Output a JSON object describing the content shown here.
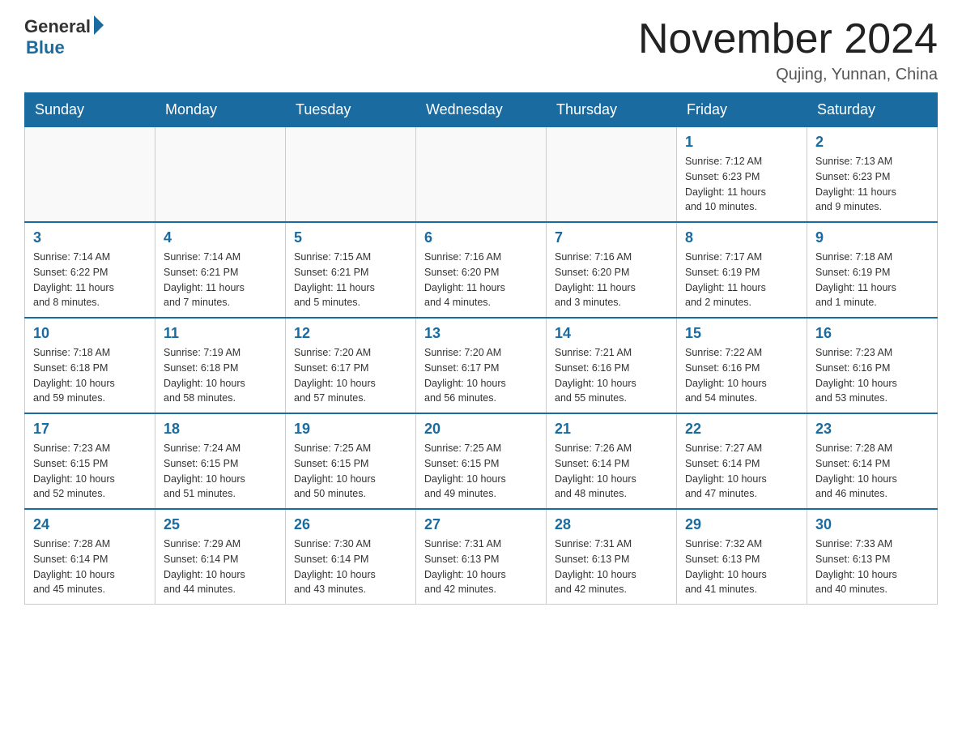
{
  "header": {
    "logo_general": "General",
    "logo_blue": "Blue",
    "month_year": "November 2024",
    "location": "Qujing, Yunnan, China"
  },
  "days_of_week": [
    "Sunday",
    "Monday",
    "Tuesday",
    "Wednesday",
    "Thursday",
    "Friday",
    "Saturday"
  ],
  "weeks": [
    [
      {
        "day": "",
        "info": ""
      },
      {
        "day": "",
        "info": ""
      },
      {
        "day": "",
        "info": ""
      },
      {
        "day": "",
        "info": ""
      },
      {
        "day": "",
        "info": ""
      },
      {
        "day": "1",
        "info": "Sunrise: 7:12 AM\nSunset: 6:23 PM\nDaylight: 11 hours\nand 10 minutes."
      },
      {
        "day": "2",
        "info": "Sunrise: 7:13 AM\nSunset: 6:23 PM\nDaylight: 11 hours\nand 9 minutes."
      }
    ],
    [
      {
        "day": "3",
        "info": "Sunrise: 7:14 AM\nSunset: 6:22 PM\nDaylight: 11 hours\nand 8 minutes."
      },
      {
        "day": "4",
        "info": "Sunrise: 7:14 AM\nSunset: 6:21 PM\nDaylight: 11 hours\nand 7 minutes."
      },
      {
        "day": "5",
        "info": "Sunrise: 7:15 AM\nSunset: 6:21 PM\nDaylight: 11 hours\nand 5 minutes."
      },
      {
        "day": "6",
        "info": "Sunrise: 7:16 AM\nSunset: 6:20 PM\nDaylight: 11 hours\nand 4 minutes."
      },
      {
        "day": "7",
        "info": "Sunrise: 7:16 AM\nSunset: 6:20 PM\nDaylight: 11 hours\nand 3 minutes."
      },
      {
        "day": "8",
        "info": "Sunrise: 7:17 AM\nSunset: 6:19 PM\nDaylight: 11 hours\nand 2 minutes."
      },
      {
        "day": "9",
        "info": "Sunrise: 7:18 AM\nSunset: 6:19 PM\nDaylight: 11 hours\nand 1 minute."
      }
    ],
    [
      {
        "day": "10",
        "info": "Sunrise: 7:18 AM\nSunset: 6:18 PM\nDaylight: 10 hours\nand 59 minutes."
      },
      {
        "day": "11",
        "info": "Sunrise: 7:19 AM\nSunset: 6:18 PM\nDaylight: 10 hours\nand 58 minutes."
      },
      {
        "day": "12",
        "info": "Sunrise: 7:20 AM\nSunset: 6:17 PM\nDaylight: 10 hours\nand 57 minutes."
      },
      {
        "day": "13",
        "info": "Sunrise: 7:20 AM\nSunset: 6:17 PM\nDaylight: 10 hours\nand 56 minutes."
      },
      {
        "day": "14",
        "info": "Sunrise: 7:21 AM\nSunset: 6:16 PM\nDaylight: 10 hours\nand 55 minutes."
      },
      {
        "day": "15",
        "info": "Sunrise: 7:22 AM\nSunset: 6:16 PM\nDaylight: 10 hours\nand 54 minutes."
      },
      {
        "day": "16",
        "info": "Sunrise: 7:23 AM\nSunset: 6:16 PM\nDaylight: 10 hours\nand 53 minutes."
      }
    ],
    [
      {
        "day": "17",
        "info": "Sunrise: 7:23 AM\nSunset: 6:15 PM\nDaylight: 10 hours\nand 52 minutes."
      },
      {
        "day": "18",
        "info": "Sunrise: 7:24 AM\nSunset: 6:15 PM\nDaylight: 10 hours\nand 51 minutes."
      },
      {
        "day": "19",
        "info": "Sunrise: 7:25 AM\nSunset: 6:15 PM\nDaylight: 10 hours\nand 50 minutes."
      },
      {
        "day": "20",
        "info": "Sunrise: 7:25 AM\nSunset: 6:15 PM\nDaylight: 10 hours\nand 49 minutes."
      },
      {
        "day": "21",
        "info": "Sunrise: 7:26 AM\nSunset: 6:14 PM\nDaylight: 10 hours\nand 48 minutes."
      },
      {
        "day": "22",
        "info": "Sunrise: 7:27 AM\nSunset: 6:14 PM\nDaylight: 10 hours\nand 47 minutes."
      },
      {
        "day": "23",
        "info": "Sunrise: 7:28 AM\nSunset: 6:14 PM\nDaylight: 10 hours\nand 46 minutes."
      }
    ],
    [
      {
        "day": "24",
        "info": "Sunrise: 7:28 AM\nSunset: 6:14 PM\nDaylight: 10 hours\nand 45 minutes."
      },
      {
        "day": "25",
        "info": "Sunrise: 7:29 AM\nSunset: 6:14 PM\nDaylight: 10 hours\nand 44 minutes."
      },
      {
        "day": "26",
        "info": "Sunrise: 7:30 AM\nSunset: 6:14 PM\nDaylight: 10 hours\nand 43 minutes."
      },
      {
        "day": "27",
        "info": "Sunrise: 7:31 AM\nSunset: 6:13 PM\nDaylight: 10 hours\nand 42 minutes."
      },
      {
        "day": "28",
        "info": "Sunrise: 7:31 AM\nSunset: 6:13 PM\nDaylight: 10 hours\nand 42 minutes."
      },
      {
        "day": "29",
        "info": "Sunrise: 7:32 AM\nSunset: 6:13 PM\nDaylight: 10 hours\nand 41 minutes."
      },
      {
        "day": "30",
        "info": "Sunrise: 7:33 AM\nSunset: 6:13 PM\nDaylight: 10 hours\nand 40 minutes."
      }
    ]
  ]
}
